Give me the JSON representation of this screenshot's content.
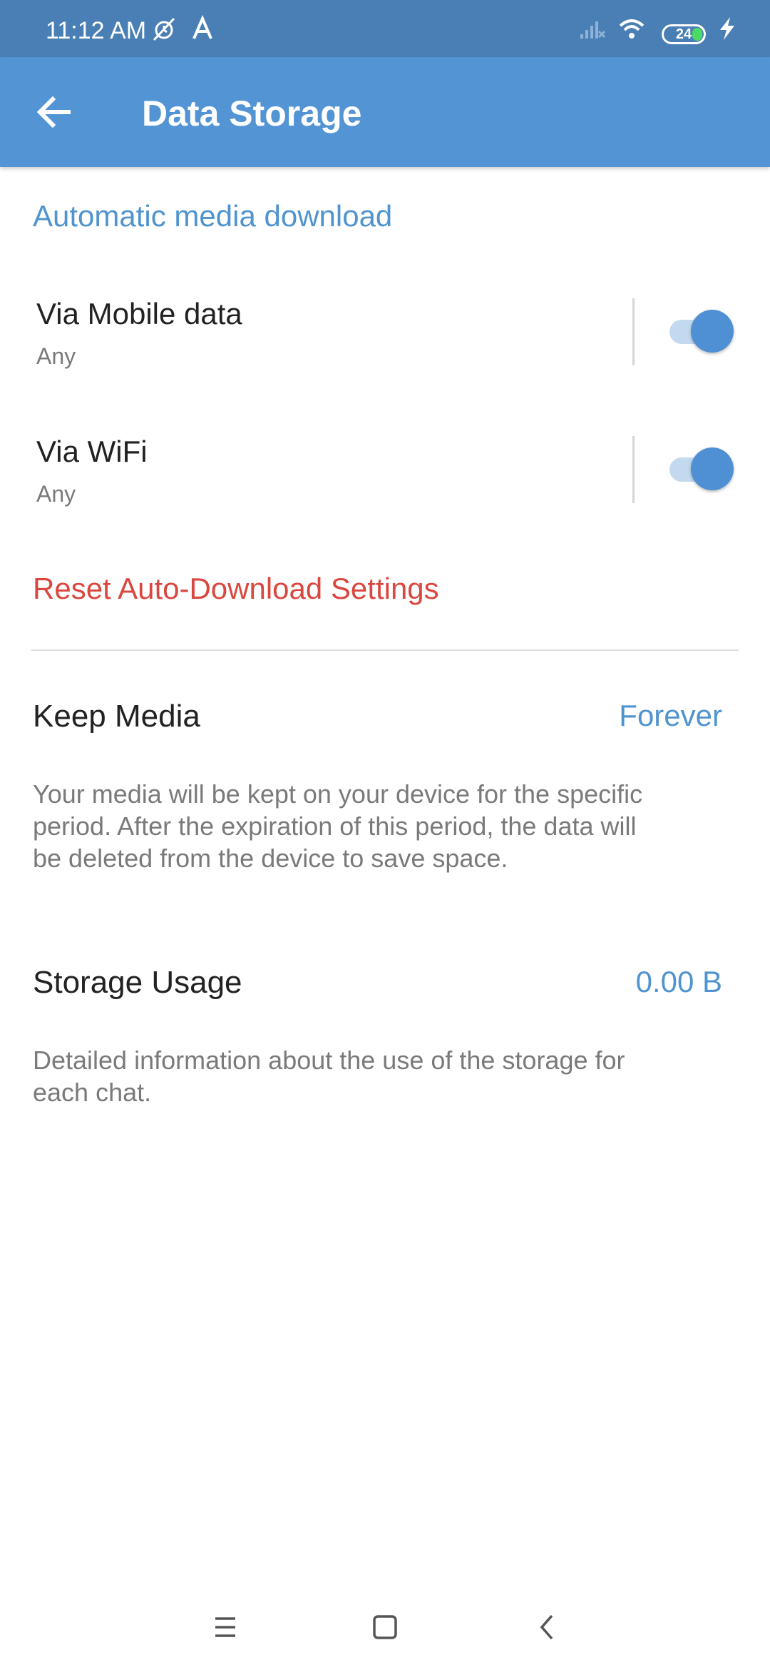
{
  "status_bar": {
    "time": "11:12 AM",
    "battery": "24",
    "icons": [
      "muted-alarm-icon",
      "a-app-icon",
      "signal-icon",
      "wifi-icon",
      "battery-icon",
      "charging-icon"
    ]
  },
  "app_bar": {
    "title": "Data Storage",
    "color": "#5294d4",
    "back_icon": "arrow-left-icon"
  },
  "auto_download": {
    "header": "Automatic media download",
    "items": [
      {
        "title": "Via Mobile data",
        "subtitle": "Any",
        "enabled": true
      },
      {
        "title": "Via WiFi",
        "subtitle": "Any",
        "enabled": true
      }
    ],
    "reset_label": "Reset Auto-Download Settings"
  },
  "keep_media": {
    "label": "Keep Media",
    "value": "Forever",
    "description": "Your media will be kept on your device for the specific period. After the expiration of this period, the data will be deleted from the device to save space."
  },
  "storage_usage": {
    "label": "Storage Usage",
    "value": "0.00 B",
    "description": "Detailed information about the use of the storage for each chat."
  },
  "colors": {
    "accent": "#4f94cf",
    "danger": "#d9473f",
    "status_bar": "#4a7fb5"
  },
  "nav_bar": {
    "icons": [
      "menu-icon",
      "home-square-icon",
      "back-chevron-icon"
    ]
  }
}
